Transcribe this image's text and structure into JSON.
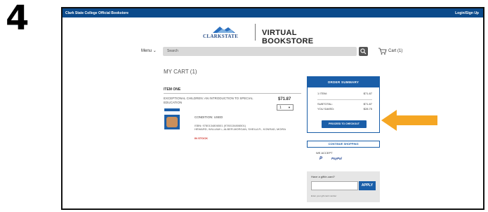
{
  "step_number": "4",
  "topbar": {
    "site_name": "Clark State College Official Bookstore",
    "login_link": "Login/Sign Up"
  },
  "header": {
    "logo_text": "CLARKSTATE",
    "store_title": "VIRTUAL BOOKSTORE",
    "menu_label": "Menu",
    "search_placeholder": "Search",
    "cart_label": "Cart (1)"
  },
  "cart": {
    "title": "MY CART (1)",
    "item_heading": "ITEM ONE",
    "item": {
      "title": "EXCEPTIONAL CHILDREN: AN INTRODUCTION TO SPECIAL EDUCATION",
      "price": "$71.87",
      "quantity": "1",
      "condition": "CONDITION: USED",
      "isbn": "ISBN: 9780134806501 (9780134806501)",
      "author": "HEWARD, WILLIAM L; ALBER-MORGAN, SHEILA R.; KONRAD, MOIRA",
      "stock_status": "IN STOCK"
    }
  },
  "order_summary": {
    "heading": "ORDER SUMMARY",
    "rows": [
      {
        "label": "1 ITEM:",
        "value": "$71.87"
      },
      {
        "label": "SUBTOTAL:",
        "value": "$71.87"
      },
      {
        "label": "YOU SAVED:",
        "value": "$28.75"
      }
    ],
    "checkout_button": "PROCEED TO CHECKOUT"
  },
  "continue_button": "CONTINUE SHOPPING",
  "payments": {
    "label": "WE ACCEPT",
    "methods": [
      "P",
      "PayPal"
    ]
  },
  "gift_card": {
    "label": "Have a gift/e-card?",
    "input_value": "",
    "apply_button": "APPLY",
    "note": "Enter your gift card number"
  },
  "colors": {
    "brand_blue": "#1a5ea8",
    "topbar_blue": "#0b4a8b",
    "arrow_orange": "#f5a623",
    "stock_red": "#d0342c"
  }
}
